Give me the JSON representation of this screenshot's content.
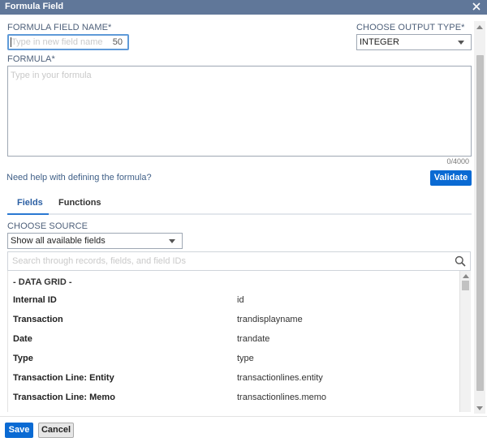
{
  "window": {
    "title": "Formula Field"
  },
  "form": {
    "name_label": "FORMULA FIELD NAME*",
    "name_placeholder": "Type in new field name",
    "name_remaining": "50",
    "output_type_label": "CHOOSE OUTPUT TYPE*",
    "output_type_value": "INTEGER",
    "formula_label": "FORMULA*",
    "formula_placeholder": "Type in your formula",
    "char_count": "0/4000",
    "help_link": "Need help with defining the formula?",
    "validate_label": "Validate"
  },
  "tabs": [
    {
      "label": "Fields",
      "active": true
    },
    {
      "label": "Functions",
      "active": false
    }
  ],
  "source": {
    "label": "CHOOSE SOURCE",
    "value": "Show all available fields",
    "search_placeholder": "Search through records, fields, and field IDs"
  },
  "grid": {
    "group_title": "- DATA GRID -",
    "rows": [
      {
        "name": "Internal ID",
        "id": "id"
      },
      {
        "name": "Transaction",
        "id": "trandisplayname"
      },
      {
        "name": "Date",
        "id": "trandate"
      },
      {
        "name": "Type",
        "id": "type"
      },
      {
        "name": "Transaction Line: Entity",
        "id": "transactionlines.entity"
      },
      {
        "name": "Transaction Line: Memo",
        "id": "transactionlines.memo"
      }
    ]
  },
  "footer": {
    "save_label": "Save",
    "cancel_label": "Cancel"
  },
  "colors": {
    "titlebar": "#607799",
    "primary": "#0a6ad3",
    "link": "#3f5f87",
    "tab_active": "#2a78d2"
  },
  "icons": {
    "close": "close-icon",
    "search": "search-icon"
  }
}
